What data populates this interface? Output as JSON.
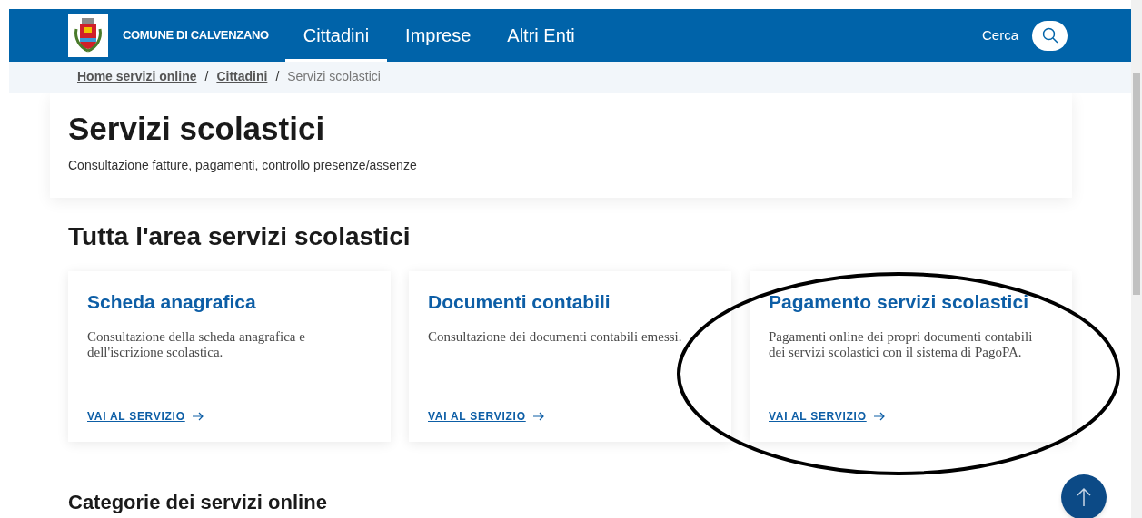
{
  "header": {
    "logo_text": "COMUNE DI CALVENZANO",
    "nav": [
      {
        "label": "Cittadini",
        "selected": true
      },
      {
        "label": "Imprese",
        "selected": false
      },
      {
        "label": "Altri Enti",
        "selected": false
      }
    ],
    "search_label": "Cerca"
  },
  "breadcrumb": [
    {
      "label": "Home servizi online",
      "kind": "link"
    },
    {
      "label": "Cittadini",
      "kind": "link"
    },
    {
      "label": "Servizi scolastici",
      "kind": "current"
    }
  ],
  "breadcrumb_separator": "/",
  "page": {
    "title": "Servizi scolastici",
    "subtitle": "Consultazione fatture, pagamenti, controllo presenze/assenze"
  },
  "section_title": "Tutta l'area servizi scolastici",
  "cards": [
    {
      "title": "Scheda anagrafica",
      "text": "Consultazione della scheda anagrafica e dell'iscrizione scolastica.",
      "link": "VAI AL SERVIZIO",
      "circled": false
    },
    {
      "title": "Documenti contabili",
      "text": "Consultazione dei documenti contabili emessi.",
      "link": "VAI AL SERVIZIO",
      "circled": false
    },
    {
      "title": "Pagamento servizi scolastici",
      "text": "Pagamenti online dei propri documenti contabili dei servizi scolastici con il sistema di PagoPA.",
      "link": "VAI AL SERVIZIO",
      "circled": true
    }
  ],
  "next_section_title": "Categorie dei servizi online"
}
